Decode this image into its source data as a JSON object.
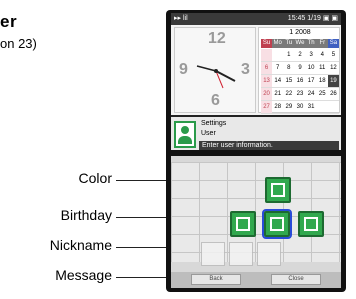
{
  "heading": "er",
  "subheading": "on 23)",
  "callouts": [
    "Color",
    "Birthday",
    "Nickname",
    "Message"
  ],
  "top_screen": {
    "status_left": "▸▸ lil",
    "status_right": "15:45  1/19 ▣ ▣",
    "calendar_title": "1 2008",
    "weekdays": [
      "Su",
      "Mo",
      "Tu",
      "We",
      "Th",
      "Fr",
      "Sa"
    ],
    "days": [
      "",
      "",
      "1",
      "2",
      "3",
      "4",
      "5",
      "6",
      "7",
      "8",
      "9",
      "10",
      "11",
      "12",
      "13",
      "14",
      "15",
      "16",
      "17",
      "18",
      "19",
      "20",
      "21",
      "22",
      "23",
      "24",
      "25",
      "26",
      "27",
      "28",
      "29",
      "30",
      "31",
      "",
      ""
    ],
    "clock_digits": [
      "12",
      "3",
      "6",
      "9"
    ],
    "info_label_1": "Settings",
    "info_label_2": "User",
    "info_bar_text": "Enter user information."
  },
  "bottom_screen": {
    "footer_left": "Back",
    "footer_right": "Close"
  }
}
